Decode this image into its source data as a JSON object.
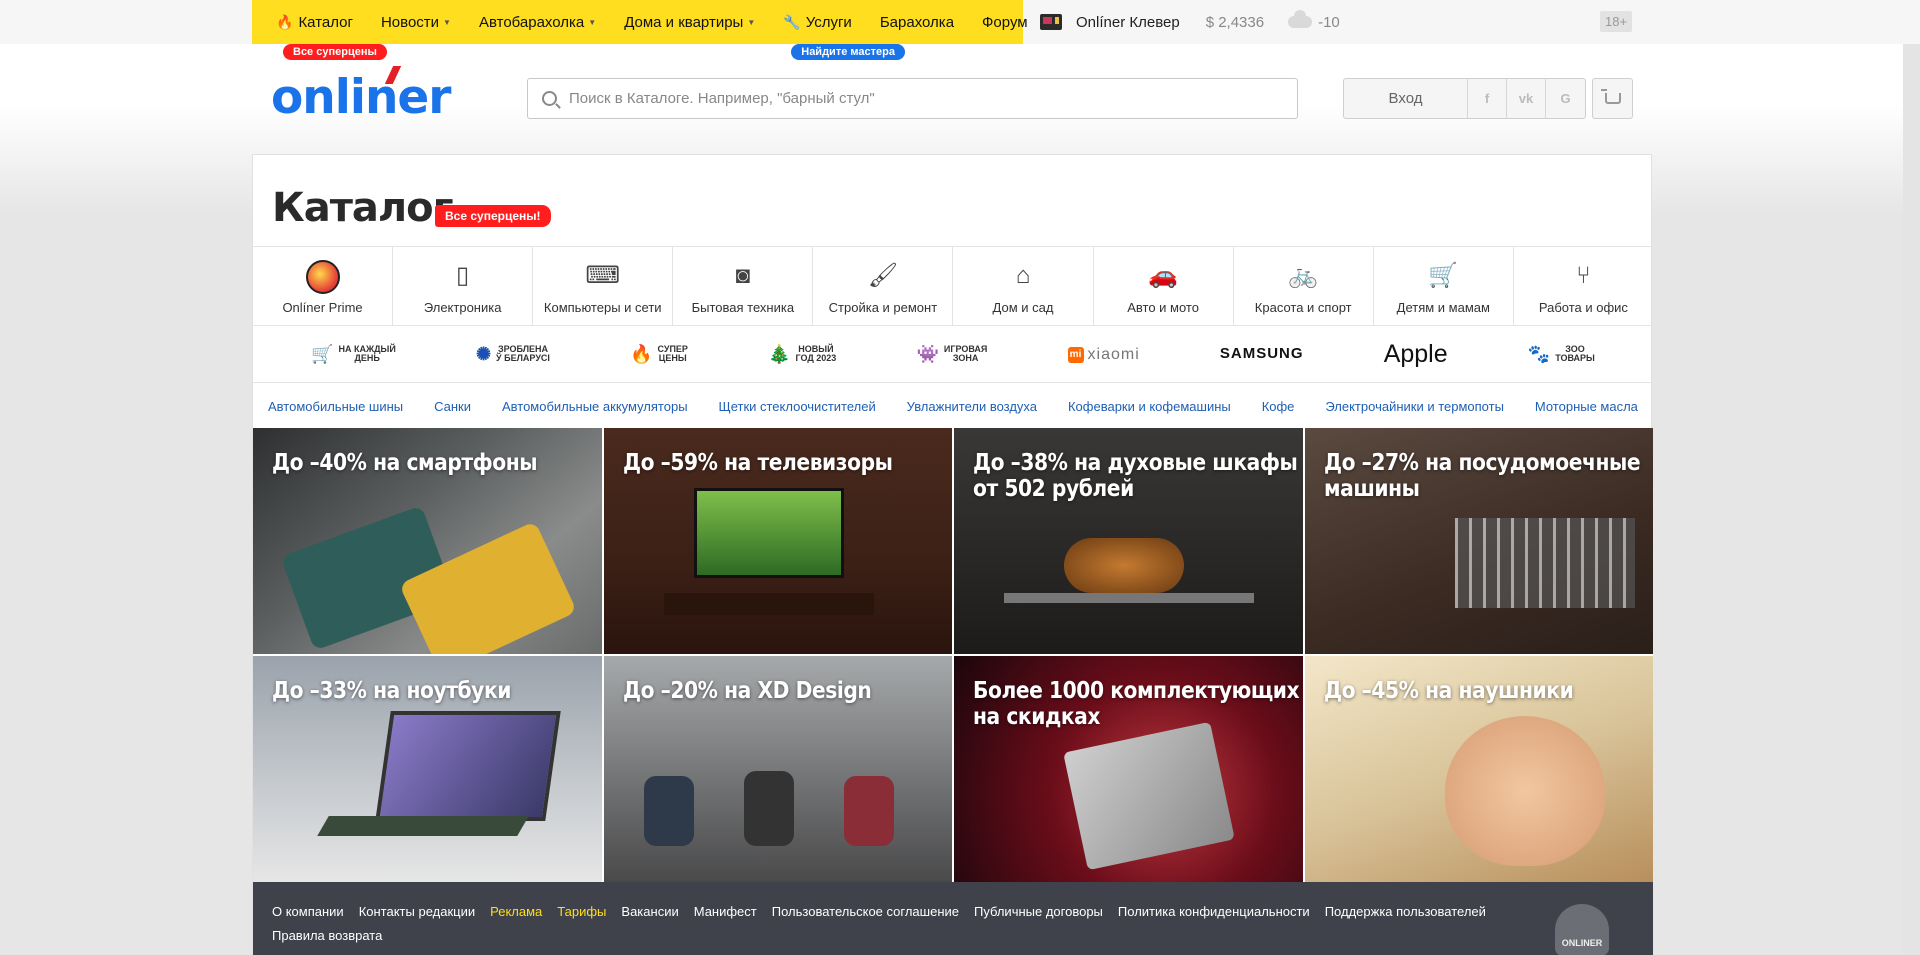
{
  "topnav": {
    "items": [
      {
        "label": "Каталог",
        "icon": "fire-icon",
        "caret": false,
        "badge": "Все суперцены",
        "badge_color": "#ff1d1d"
      },
      {
        "label": "Новости",
        "caret": true
      },
      {
        "label": "Автобарахолка",
        "caret": true
      },
      {
        "label": "Дома и квартиры",
        "caret": true
      },
      {
        "label": "Услуги",
        "icon": "wrench-icon",
        "caret": false,
        "badge": "Найдите мастера",
        "badge_color": "#1a73e8"
      },
      {
        "label": "Барахолка",
        "caret": false
      },
      {
        "label": "Форум",
        "caret": false
      }
    ],
    "clever": "Onlíner Клевер",
    "rate": "$ 2,4336",
    "temperature": "-10",
    "age": "18+"
  },
  "header": {
    "logo": "onliner",
    "search_placeholder": "Поиск в Каталоге. Например, \"барный стул\"",
    "login": "Вход",
    "socials": [
      "f",
      "vk",
      "G"
    ]
  },
  "catalog": {
    "title": "Каталог",
    "badge": "Все суперцены!",
    "categories": [
      {
        "label": "Onlíner Prime",
        "icon": "prime-icon"
      },
      {
        "label": "Электроника",
        "icon": "smartphone-icon"
      },
      {
        "label": "Компьютеры и сети",
        "icon": "laptop-icon"
      },
      {
        "label": "Бытовая техника",
        "icon": "washing-machine-icon"
      },
      {
        "label": "Стройка и ремонт",
        "icon": "paint-roller-icon"
      },
      {
        "label": "Дом и сад",
        "icon": "house-icon"
      },
      {
        "label": "Авто и мото",
        "icon": "car-icon"
      },
      {
        "label": "Красота и спорт",
        "icon": "bicycle-icon"
      },
      {
        "label": "Детям и мамам",
        "icon": "stroller-icon"
      },
      {
        "label": "Работа и офис",
        "icon": "office-chair-icon"
      }
    ],
    "promos": [
      {
        "mark": "🛒",
        "line1": "НА КАЖДЫЙ",
        "line2": "ДЕНЬ"
      },
      {
        "mark": "✺",
        "line1": "ЗРОБЛЕНА",
        "line2": "Ў БЕЛАРУСІ"
      },
      {
        "mark": "🔥",
        "line1": "СУПЕР",
        "line2": "ЦЕНЫ"
      },
      {
        "mark": "🎄",
        "line1": "НОВЫЙ",
        "line2": "ГОД 2023"
      },
      {
        "mark": "👾",
        "line1": "ИГРОВАЯ",
        "line2": "ЗОНА"
      },
      {
        "brand": "xiaomi",
        "text": "xiaomi"
      },
      {
        "brand": "samsung",
        "text": "SAMSUNG"
      },
      {
        "brand": "apple",
        "text": "Apple"
      },
      {
        "mark": "🐾",
        "line1": "ЗОО",
        "line2": "ТОВАРЫ"
      }
    ],
    "quicklinks": [
      "Автомобильные шины",
      "Санки",
      "Автомобильные аккумуляторы",
      "Щетки стеклоочистителей",
      "Увлажнители воздуха",
      "Кофеварки и кофемашины",
      "Кофе",
      "Электрочайники и термопоты",
      "Моторные масла"
    ],
    "tiles": [
      {
        "title": "До –40% на смартфоны"
      },
      {
        "title": "До –59% на телевизоры"
      },
      {
        "title": "До –38% на духовые шкафы от 502 рублей"
      },
      {
        "title": "До –27% на посудомоечные машины"
      },
      {
        "title": "До –33% на ноутбуки"
      },
      {
        "title": "До –20% на XD Design"
      },
      {
        "title": "Более 1000 комплектующих на скидках"
      },
      {
        "title": "До –45% на наушники"
      }
    ]
  },
  "footer": {
    "links": [
      {
        "label": "О компании"
      },
      {
        "label": "Контакты редакции"
      },
      {
        "label": "Реклама",
        "highlight": true
      },
      {
        "label": "Тарифы",
        "highlight": true
      },
      {
        "label": "Вакансии"
      },
      {
        "label": "Манифест"
      },
      {
        "label": "Пользовательское соглашение"
      },
      {
        "label": "Публичные договоры"
      },
      {
        "label": "Политика конфиденциальности"
      },
      {
        "label": "Поддержка пользователей"
      },
      {
        "label": "Правила возврата"
      }
    ],
    "mascot_text": "ONLINER"
  }
}
